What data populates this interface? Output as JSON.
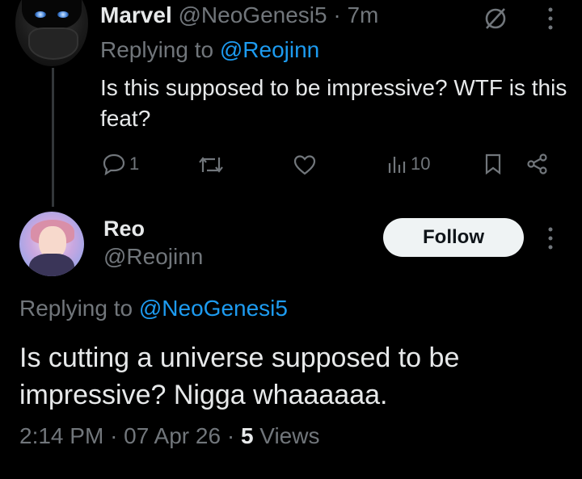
{
  "tweet1": {
    "name": "Marvel",
    "handle": "@NeoGenesi5",
    "separator": "·",
    "time": "7m",
    "replying_prefix": "Replying to ",
    "replying_handle": "@Reojinn",
    "text": "Is this supposed to be impressive? WTF is this feat?",
    "actions": {
      "reply_count": "1",
      "views_count": "10"
    },
    "icons": [
      "muted-icon",
      "more-icon",
      "reply-icon",
      "retweet-icon",
      "like-icon",
      "views-icon",
      "bookmark-icon",
      "share-icon"
    ]
  },
  "tweet2": {
    "name": "Reo",
    "handle": "@Reojinn",
    "follow_label": "Follow",
    "replying_prefix": "Replying to ",
    "replying_handle": "@NeoGenesi5",
    "text": "Is cutting a universe supposed to be impressive? Nigga whaaaaaa.",
    "time": "2:14 PM",
    "date": "07 Apr 26",
    "separator": "·",
    "views_count": "5",
    "views_label": " Views"
  },
  "colors": {
    "background": "#000000",
    "text": "#e7e9ea",
    "muted": "#71767b",
    "link": "#1d9bf0",
    "follow_bg": "#eff3f4"
  }
}
